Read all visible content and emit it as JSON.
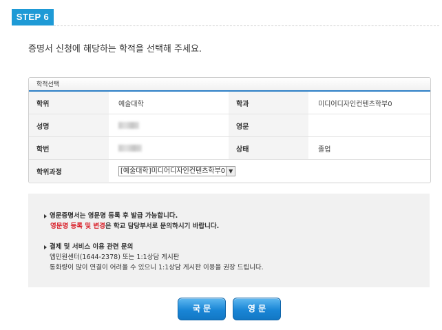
{
  "step": {
    "label": "STEP 6"
  },
  "instruction": "증명서 신청에 해당하는 학적을 선택해 주세요.",
  "panel": {
    "title": "학적선택",
    "rows": [
      {
        "l1": "학위",
        "v1": "예술대학",
        "l2": "학과",
        "v2": "미디어디자인컨텐츠학부0"
      },
      {
        "l1": "성명",
        "v1": "",
        "l2": "영문",
        "v2": ""
      },
      {
        "l1": "학번",
        "v1": "",
        "l2": "상태",
        "v2": "졸업"
      }
    ],
    "course_label": "학위과정",
    "course_selected": "[예술대학]미디어디자인컨텐츠학부0"
  },
  "notice": {
    "line1": "영문증명서는 영문명 등록 후 발급 가능합니다.",
    "line2_red": "영문명 등록 및 변경",
    "line2_rest": "은 학교 담당부서로 문의하시기 바랍니다.",
    "line3": "결제 및 서비스 이용 관련 문의",
    "line4": "엡민원센터(1644-2378) 또는 1:1상담 게시판",
    "line5": "통화량이 많이 연결이 어려울 수 있으니 1:1상담 게시판 이용을 권장 드립니다."
  },
  "buttons": {
    "korean": "국 문",
    "english": "영 문"
  },
  "colors": {
    "accent": "#1e9ad6",
    "warning": "#d9212b"
  }
}
